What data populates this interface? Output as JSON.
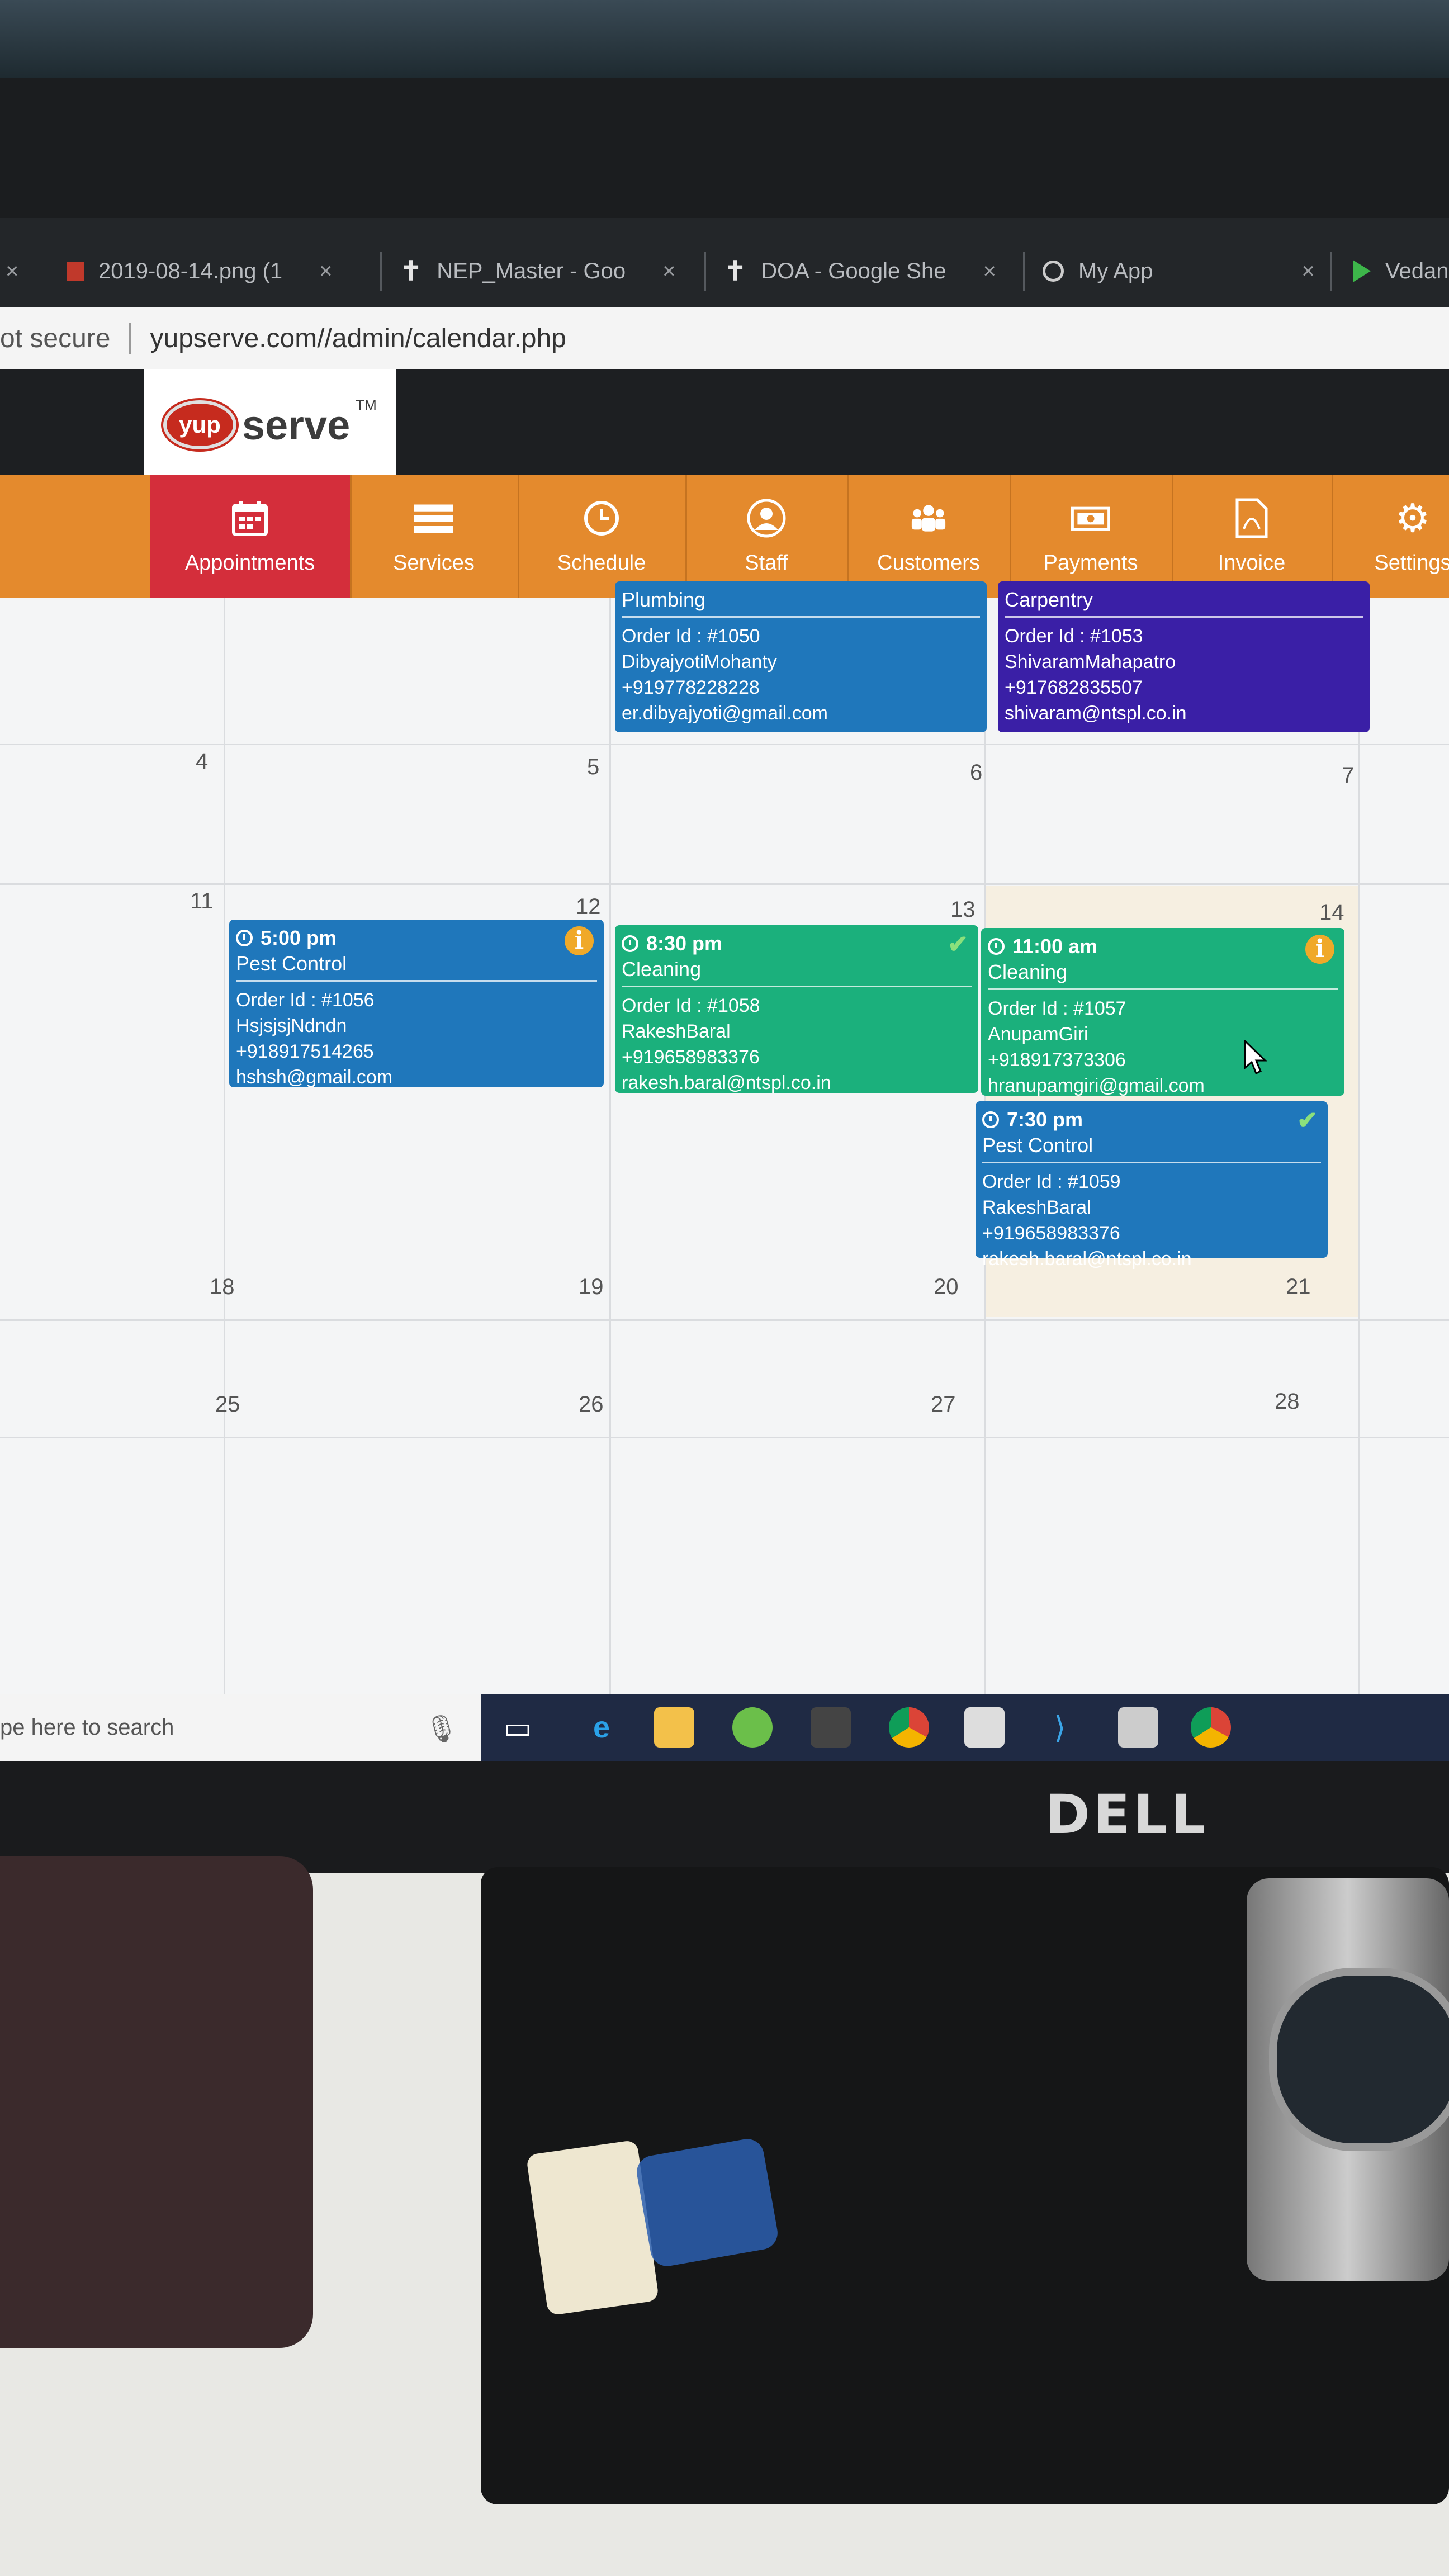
{
  "browser": {
    "tabs": [
      {
        "title": "2019-08-14.png (1",
        "icon": "image-icon"
      },
      {
        "title": "NEP_Master - Goo",
        "icon": "sheets-icon"
      },
      {
        "title": "DOA - Google She",
        "icon": "sheets-icon"
      },
      {
        "title": "My App",
        "icon": "github-icon"
      },
      {
        "title": "Vedan",
        "icon": "play-icon"
      }
    ],
    "close_glyph": "×",
    "security_label": "ot secure",
    "url": "yupserve.com//admin/calendar.php"
  },
  "site": {
    "logo_badge": "yup",
    "logo_text": "serve",
    "logo_tm": "TM"
  },
  "nav": {
    "items": [
      {
        "label": "Appointments",
        "icon": "calendar-icon",
        "active": true
      },
      {
        "label": "Services",
        "icon": "list-icon"
      },
      {
        "label": "Schedule",
        "icon": "clock-icon"
      },
      {
        "label": "Staff",
        "icon": "user-icon"
      },
      {
        "label": "Customers",
        "icon": "users-icon"
      },
      {
        "label": "Payments",
        "icon": "money-icon"
      },
      {
        "label": "Invoice",
        "icon": "pdf-icon"
      },
      {
        "label": "Settings",
        "icon": "gear-icon"
      }
    ],
    "active_color": "#d42e3b",
    "bar_color": "#e48a2d"
  },
  "calendar": {
    "day_numbers": {
      "d4": "4",
      "d5": "5",
      "d6": "6",
      "d7": "7",
      "d11": "11",
      "d12": "12",
      "d13": "13",
      "d14": "14",
      "d18": "18",
      "d19": "19",
      "d20": "20",
      "d21": "21",
      "d25": "25",
      "d26": "26",
      "d27": "27",
      "d28": "28"
    },
    "events": {
      "e1050": {
        "type": "Plumbing",
        "order": "Order Id : #1050",
        "name": "DibyajyotiMohanty",
        "phone": "+919778228228",
        "email": "er.dibyajyoti@gmail.com"
      },
      "e1053": {
        "type": "Carpentry",
        "order": "Order Id : #1053",
        "name": "ShivaramMahapatro",
        "phone": "+917682835507",
        "email": "shivaram@ntspl.co.in"
      },
      "e1056": {
        "time": "5:00 pm",
        "type": "Pest Control",
        "order": "Order Id : #1056",
        "name": "HsjsjsjNdndn",
        "phone": "+918917514265",
        "email": "hshsh@gmail.com",
        "status_icon": "info-icon"
      },
      "e1058": {
        "time": "8:30 pm",
        "type": "Cleaning",
        "order": "Order Id : #1058",
        "name": "RakeshBaral",
        "phone": "+919658983376",
        "email": "rakesh.baral@ntspl.co.in",
        "status_icon": "check-icon"
      },
      "e1057": {
        "time": "11:00 am",
        "type": "Cleaning",
        "order": "Order Id : #1057",
        "name": "AnupamGiri",
        "phone": "+918917373306",
        "email": "hranupamgiri@gmail.com",
        "status_icon": "info-icon"
      },
      "e1059": {
        "time": "7:30 pm",
        "type": "Pest Control",
        "order": "Order Id : #1059",
        "name": "RakeshBaral",
        "phone": "+919658983376",
        "email": "rakesh.baral@ntspl.co.in",
        "status_icon": "check-icon"
      }
    },
    "colors": {
      "blue": "#1f77bb",
      "green": "#1bb07c",
      "purple": "#3a1fa6"
    }
  },
  "taskbar": {
    "search_placeholder": "pe here to search",
    "icons": [
      "mic-icon",
      "task-view-icon",
      "edge-icon",
      "file-explorer-icon",
      "app-icon",
      "photos-icon",
      "chrome-icon",
      "terminal-icon",
      "vscode-icon",
      "network-icon",
      "chrome-icon"
    ]
  },
  "hardware": {
    "monitor_brand": "DELL"
  }
}
